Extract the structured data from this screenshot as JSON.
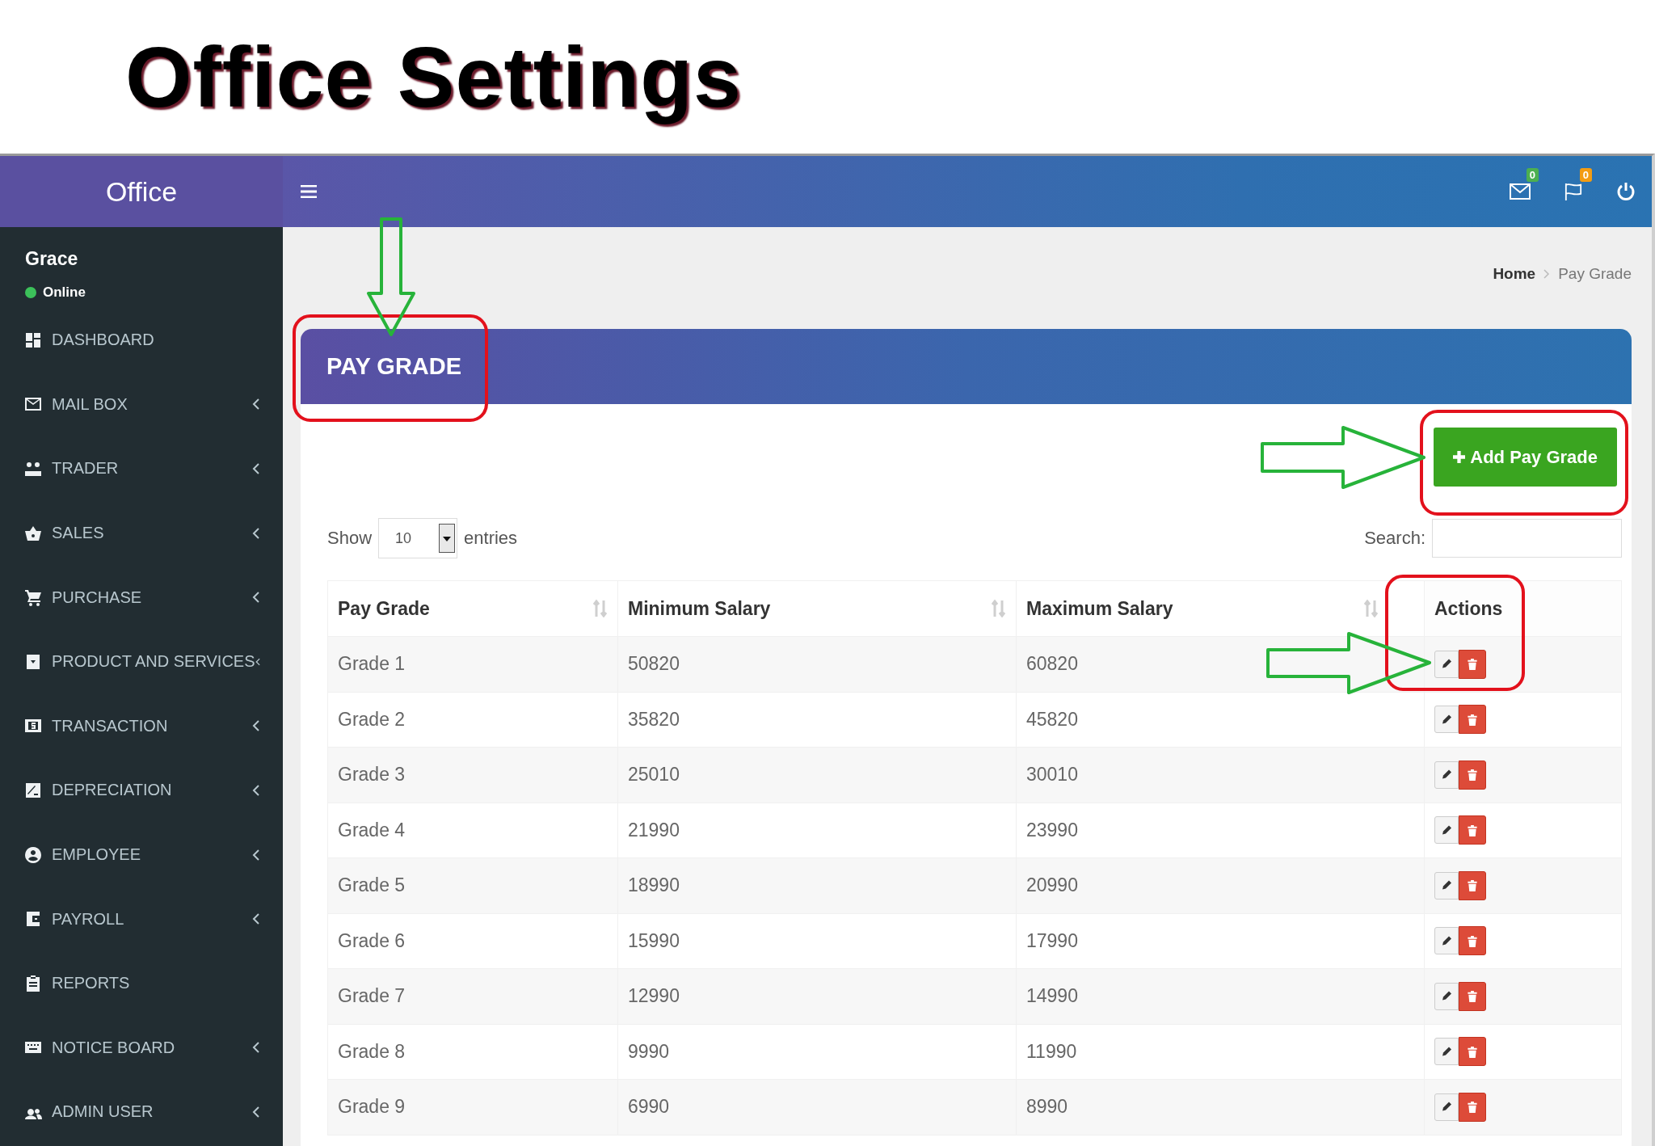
{
  "slide_title": "Office Settings",
  "app": {
    "logo": "Office",
    "user": {
      "name": "Grace",
      "status": "Online"
    },
    "sidebar": {
      "items": [
        {
          "label": "DASHBOARD",
          "has_submenu": false
        },
        {
          "label": "MAIL BOX",
          "has_submenu": true
        },
        {
          "label": "TRADER",
          "has_submenu": true
        },
        {
          "label": "SALES",
          "has_submenu": true
        },
        {
          "label": "PURCHASE",
          "has_submenu": true
        },
        {
          "label": "PRODUCT AND SERVICES",
          "has_submenu": true
        },
        {
          "label": "TRANSACTION",
          "has_submenu": true
        },
        {
          "label": "DEPRECIATION",
          "has_submenu": true
        },
        {
          "label": "EMPLOYEE",
          "has_submenu": true
        },
        {
          "label": "PAYROLL",
          "has_submenu": true
        },
        {
          "label": "REPORTS",
          "has_submenu": false
        },
        {
          "label": "NOTICE BOARD",
          "has_submenu": true
        },
        {
          "label": "ADMIN USER",
          "has_submenu": true
        }
      ]
    },
    "topbar": {
      "badges": [
        {
          "count": "0",
          "color": "#4caf50"
        },
        {
          "count": "0",
          "color": "#f39c12"
        }
      ]
    },
    "breadcrumb": [
      "Home",
      "Pay Grade"
    ],
    "panel": {
      "title": "PAY GRADE",
      "highlighted": true,
      "arrow": true,
      "add_button": {
        "label": "Add Pay Grade",
        "highlighted": true,
        "arrow": true
      },
      "show": {
        "label_before": "Show",
        "value": "10",
        "label_after": "entries"
      },
      "search": {
        "label": "Search:"
      },
      "table": {
        "actions_highlighted": true,
        "columns": [
          {
            "label": "Pay Grade",
            "sortable": true
          },
          {
            "label": "Minimum Salary",
            "sortable": true
          },
          {
            "label": "Maximum Salary",
            "sortable": true
          },
          {
            "label": "Actions",
            "sortable": false
          }
        ],
        "rows": [
          {
            "grade": "Grade 1",
            "min": "50820",
            "max": "60820",
            "arrow": true
          },
          {
            "grade": "Grade 2",
            "min": "35820",
            "max": "45820",
            "arrow": false
          },
          {
            "grade": "Grade 3",
            "min": "25010",
            "max": "30010",
            "arrow": false
          },
          {
            "grade": "Grade 4",
            "min": "21990",
            "max": "23990",
            "arrow": false
          },
          {
            "grade": "Grade 5",
            "min": "18990",
            "max": "20990",
            "arrow": false
          },
          {
            "grade": "Grade 6",
            "min": "15990",
            "max": "17990",
            "arrow": false
          },
          {
            "grade": "Grade 7",
            "min": "12990",
            "max": "14990",
            "arrow": false
          },
          {
            "grade": "Grade 8",
            "min": "9990",
            "max": "11990",
            "arrow": false
          },
          {
            "grade": "Grade 9",
            "min": "6990",
            "max": "8990",
            "arrow": false
          }
        ]
      }
    }
  }
}
